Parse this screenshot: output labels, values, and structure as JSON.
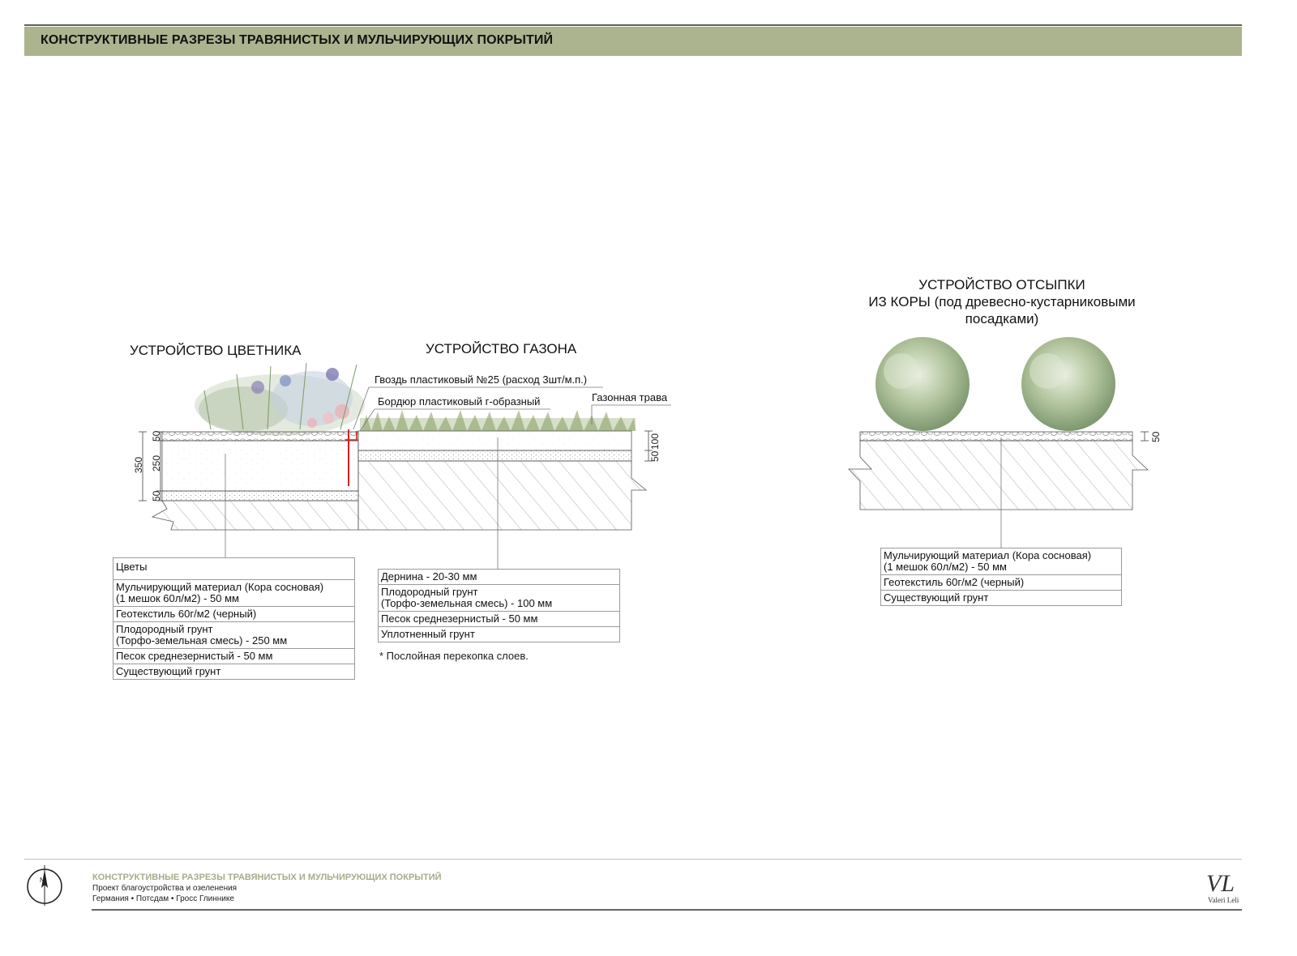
{
  "header": {
    "title": "КОНСТРУКТИВНЫЕ РАЗРЕЗЫ ТРАВЯНИСТЫХ И МУЛЬЧИРУЮЩИХ ПОКРЫТИЙ"
  },
  "flowerbed": {
    "title": "УСТРОЙСТВО ЦВЕТНИКА",
    "dims": [
      "50",
      "250",
      "50"
    ],
    "total": "350",
    "legend": [
      "Цветы",
      "Мульчирующий материал (Кора сосновая)\n(1 мешок 60л/м2)  - 50 мм",
      "Геотекстиль 60г/м2 (черный)",
      "Плодородный грунт\n(Торфо-земельная смесь)  - 250 мм",
      "Песок среднезернистый - 50 мм",
      "Существующий грунт"
    ]
  },
  "lawn": {
    "title": "УСТРОЙСТВО ГАЗОНА",
    "callouts": {
      "nail": "Гвоздь пластиковый №25 (расход 3шт/м.п.)",
      "border": "Бордюр пластиковый г-образный",
      "grass": "Газонная трава"
    },
    "dims": [
      "100",
      "50"
    ],
    "legend": [
      "Дернина   - 20-30 мм",
      "Плодородный грунт\n(Торфо-земельная смесь)  - 100 мм",
      "Песок среднезернистый - 50 мм",
      "Уплотненный грунт"
    ],
    "note": "*  Послойная перекопка слоев."
  },
  "bark": {
    "title_lines": [
      "УСТРОЙСТВО ОТСЫПКИ",
      "ИЗ КОРЫ (под древесно-кустарниковыми",
      "посадками)"
    ],
    "dims": [
      "50"
    ],
    "legend": [
      "Мульчирующий материал (Кора сосновая)\n(1 мешок 60л/м2)  - 50 мм",
      "Геотекстиль 60г/м2 (черный)",
      "Существующий грунт"
    ]
  },
  "footer": {
    "title": "КОНСТРУКТИВНЫЕ РАЗРЕЗЫ ТРАВЯНИСТЫХ И МУЛЬЧИРУЮЩИХ ПОКРЫТИЙ",
    "line2": "Проект благоустройства и озеленения",
    "line3": "Германия  •  Потсдам  •  Гросс Глиннике",
    "compass_letter": "N",
    "logo_mark": "VL",
    "logo_text": "Valeri Leli"
  },
  "colors": {
    "header_bar": "#abb48f",
    "accent_text": "#a4ad88",
    "red_nail": "#d42020",
    "grass": "#7f9a5a",
    "shrub": "#9fb489"
  }
}
